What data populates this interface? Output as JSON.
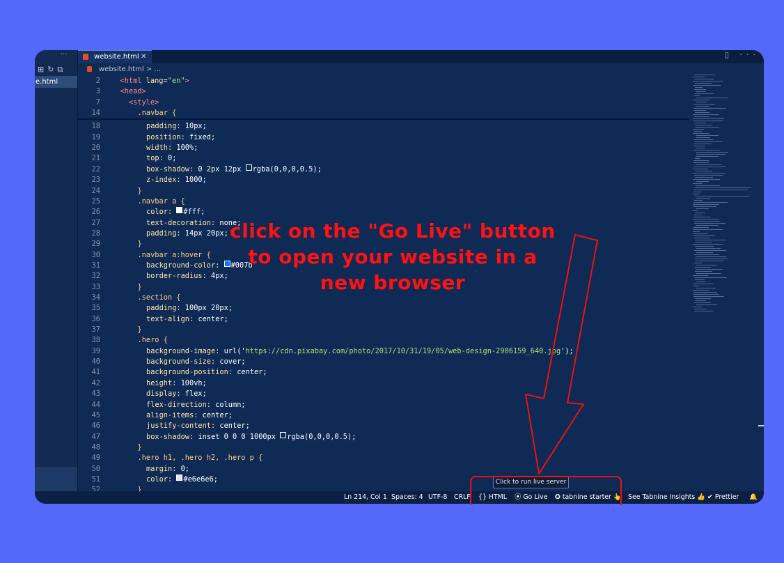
{
  "editor": {
    "tab": {
      "label": "website.html",
      "close": "✕"
    },
    "breadcrumb": "website.html > ...",
    "sidebar": {
      "more": "···",
      "file": "e.html"
    },
    "top_right_icons": "▯ ···",
    "lines": [
      {
        "n": "2",
        "indent": 2,
        "parts": [
          [
            "tag",
            "<html "
          ],
          [
            "prop",
            "lang"
          ],
          [
            "val",
            "="
          ],
          [
            "str",
            "\"en\""
          ],
          [
            "tag",
            ">"
          ]
        ]
      },
      {
        "n": "3",
        "indent": 2,
        "parts": [
          [
            "tag",
            "<head>"
          ]
        ]
      },
      {
        "n": "7",
        "indent": 4,
        "parts": [
          [
            "tag",
            "<style>"
          ]
        ]
      },
      {
        "n": "14",
        "indent": 6,
        "parts": [
          [
            "sel",
            ".navbar {"
          ]
        ]
      },
      {
        "n": "18",
        "indent": 8,
        "parts": [
          [
            "prop",
            "padding: "
          ],
          [
            "val",
            "10px;"
          ]
        ]
      },
      {
        "n": "19",
        "indent": 8,
        "parts": [
          [
            "prop",
            "position: "
          ],
          [
            "val",
            "fixed;"
          ]
        ]
      },
      {
        "n": "20",
        "indent": 8,
        "parts": [
          [
            "prop",
            "width: "
          ],
          [
            "val",
            "100%;"
          ]
        ]
      },
      {
        "n": "21",
        "indent": 8,
        "parts": [
          [
            "prop",
            "top: "
          ],
          [
            "val",
            "0;"
          ]
        ]
      },
      {
        "n": "22",
        "indent": 8,
        "parts": [
          [
            "prop",
            "box-shadow: "
          ],
          [
            "val",
            "0 2px 12px "
          ],
          [
            "swatch",
            "transparent"
          ],
          [
            "val",
            "rgba(0,0,0,0.5);"
          ]
        ]
      },
      {
        "n": "23",
        "indent": 8,
        "parts": [
          [
            "prop",
            "z-index: "
          ],
          [
            "val",
            "1000;"
          ]
        ]
      },
      {
        "n": "24",
        "indent": 6,
        "parts": [
          [
            "sel",
            "}"
          ]
        ]
      },
      {
        "n": "25",
        "indent": 6,
        "parts": [
          [
            "sel",
            ".navbar a {"
          ]
        ]
      },
      {
        "n": "26",
        "indent": 8,
        "parts": [
          [
            "prop",
            "color: "
          ],
          [
            "swatch",
            "#ffffff"
          ],
          [
            "val",
            "#fff;"
          ]
        ]
      },
      {
        "n": "27",
        "indent": 8,
        "parts": [
          [
            "prop",
            "text-decoration: "
          ],
          [
            "val",
            "none;"
          ]
        ]
      },
      {
        "n": "28",
        "indent": 8,
        "parts": [
          [
            "prop",
            "padding: "
          ],
          [
            "val",
            "14px 20px;"
          ]
        ]
      },
      {
        "n": "29",
        "indent": 6,
        "parts": [
          [
            "sel",
            "}"
          ]
        ]
      },
      {
        "n": "30",
        "indent": 6,
        "parts": [
          [
            "sel",
            ".navbar a:hover {"
          ]
        ]
      },
      {
        "n": "31",
        "indent": 8,
        "parts": [
          [
            "prop",
            "background-color: "
          ],
          [
            "swatch",
            "#007bff"
          ],
          [
            "val",
            "#007b"
          ]
        ]
      },
      {
        "n": "32",
        "indent": 8,
        "parts": [
          [
            "prop",
            "border-radius: "
          ],
          [
            "val",
            "4px;"
          ]
        ]
      },
      {
        "n": "33",
        "indent": 6,
        "parts": [
          [
            "sel",
            "}"
          ]
        ]
      },
      {
        "n": "34",
        "indent": 6,
        "parts": [
          [
            "sel",
            ".section {"
          ]
        ]
      },
      {
        "n": "35",
        "indent": 8,
        "parts": [
          [
            "prop",
            "padding: "
          ],
          [
            "val",
            "100px 20px;"
          ]
        ]
      },
      {
        "n": "36",
        "indent": 8,
        "parts": [
          [
            "prop",
            "text-align: "
          ],
          [
            "val",
            "center;"
          ]
        ]
      },
      {
        "n": "37",
        "indent": 6,
        "parts": [
          [
            "sel",
            "}"
          ]
        ]
      },
      {
        "n": "38",
        "indent": 6,
        "parts": [
          [
            "sel",
            ".hero {"
          ]
        ]
      },
      {
        "n": "39",
        "indent": 8,
        "parts": [
          [
            "prop",
            "background-image: "
          ],
          [
            "val",
            "url('"
          ],
          [
            "str",
            "https://cdn.pixabay.com/photo/2017/10/31/19/05/web-design-2906159_640.jpg"
          ],
          [
            "val",
            "');"
          ]
        ]
      },
      {
        "n": "40",
        "indent": 8,
        "parts": [
          [
            "prop",
            "background-size: "
          ],
          [
            "val",
            "cover;"
          ]
        ]
      },
      {
        "n": "41",
        "indent": 8,
        "parts": [
          [
            "prop",
            "background-position: "
          ],
          [
            "val",
            "center;"
          ]
        ]
      },
      {
        "n": "42",
        "indent": 8,
        "parts": [
          [
            "prop",
            "height: "
          ],
          [
            "val",
            "100vh;"
          ]
        ]
      },
      {
        "n": "43",
        "indent": 8,
        "parts": [
          [
            "prop",
            "display: "
          ],
          [
            "val",
            "flex;"
          ]
        ]
      },
      {
        "n": "44",
        "indent": 8,
        "parts": [
          [
            "prop",
            "flex-direction: "
          ],
          [
            "val",
            "column;"
          ]
        ]
      },
      {
        "n": "45",
        "indent": 8,
        "parts": [
          [
            "prop",
            "align-items: "
          ],
          [
            "val",
            "center;"
          ]
        ]
      },
      {
        "n": "46",
        "indent": 8,
        "parts": [
          [
            "prop",
            "justify-content: "
          ],
          [
            "val",
            "center;"
          ]
        ]
      },
      {
        "n": "47",
        "indent": 8,
        "parts": [
          [
            "prop",
            "box-shadow: "
          ],
          [
            "val",
            "inset 0 0 0 1000px "
          ],
          [
            "swatch",
            "transparent"
          ],
          [
            "val",
            "rgba(0,0,0,0.5);"
          ]
        ]
      },
      {
        "n": "48",
        "indent": 6,
        "parts": [
          [
            "sel",
            "}"
          ]
        ]
      },
      {
        "n": "49",
        "indent": 6,
        "parts": [
          [
            "sel",
            ".hero h1, .hero h2, .hero p {"
          ]
        ]
      },
      {
        "n": "50",
        "indent": 8,
        "parts": [
          [
            "prop",
            "margin: "
          ],
          [
            "val",
            "0;"
          ]
        ]
      },
      {
        "n": "51",
        "indent": 8,
        "parts": [
          [
            "prop",
            "color: "
          ],
          [
            "swatch",
            "#e6e6e6"
          ],
          [
            "val",
            "#e6e6e6;"
          ]
        ]
      },
      {
        "n": "52",
        "indent": 6,
        "parts": [
          [
            "sel",
            "}"
          ]
        ]
      }
    ]
  },
  "statusbar": {
    "position": "Ln 214, Col 1",
    "spaces": "Spaces: 4",
    "encoding": "UTF-8",
    "eol": "CRLF",
    "language": "{} HTML",
    "go_live": "⦿ Go Live",
    "tabnine": "✪ tabnine starter 👆",
    "insights": "See Tabnine Insights 👍",
    "prettier": "✔ Prettier",
    "bell": "🔔"
  },
  "tooltip": "Click to run live server",
  "annotation": {
    "lines": [
      "click on the \"Go Live\" button",
      "to open your website in a",
      "new browser"
    ]
  },
  "colors": {
    "background": "#5468fc",
    "editor_bg": "#0f2a55",
    "annotation": "#fe1212"
  }
}
